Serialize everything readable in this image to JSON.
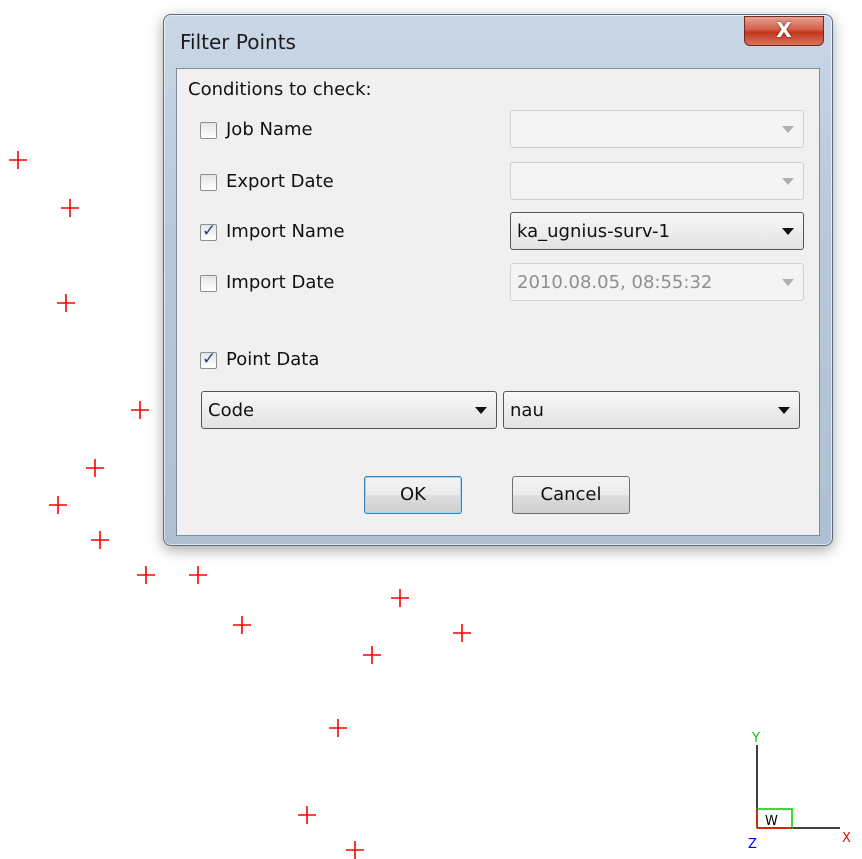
{
  "dialog": {
    "title": "Filter Points",
    "close_label": "X",
    "section_label": "Conditions to check:",
    "conditions": [
      {
        "label": "Job Name",
        "checked": false,
        "value": "",
        "enabled": false
      },
      {
        "label": "Export Date",
        "checked": false,
        "value": "",
        "enabled": false
      },
      {
        "label": "Import Name",
        "checked": true,
        "value": "ka_ugnius-surv-1",
        "enabled": true
      },
      {
        "label": "Import Date",
        "checked": false,
        "value": "2010.08.05, 08:55:32",
        "enabled": false
      }
    ],
    "point_data": {
      "label": "Point Data",
      "checked": true,
      "field": "Code",
      "value": "nau"
    },
    "ok_label": "OK",
    "cancel_label": "Cancel"
  },
  "axis": {
    "y_label": "Y",
    "x_label": "X",
    "z_label": "Z",
    "w_label": "W"
  },
  "colors": {
    "point_marker": "#ff0000",
    "axis_y": "#00cc00",
    "axis_x": "#ff0000",
    "axis_z": "#0000ff"
  }
}
